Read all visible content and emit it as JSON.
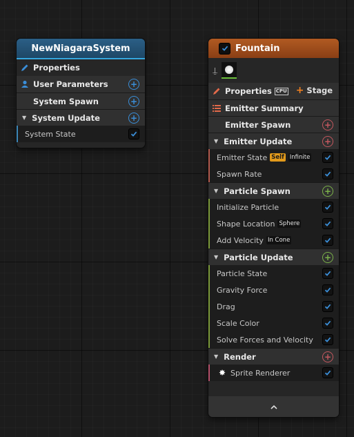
{
  "system_node": {
    "title": "NewNiagaraSystem",
    "rows": {
      "properties": "Properties",
      "user_parameters": "User Parameters",
      "system_spawn": "System Spawn",
      "system_update": "System Update",
      "system_state": "System State"
    }
  },
  "emitter_node": {
    "title": "Fountain",
    "properties": "Properties",
    "cpu_badge": "CPU",
    "stage": "Stage",
    "emitter_summary": "Emitter Summary",
    "emitter_spawn": "Emitter Spawn",
    "emitter_update": {
      "label": "Emitter Update",
      "items": {
        "emitter_state": {
          "label": "Emitter State",
          "badge1": "Self",
          "badge2": "Infinite"
        },
        "spawn_rate": "Spawn Rate"
      }
    },
    "particle_spawn": {
      "label": "Particle Spawn",
      "items": {
        "initialize_particle": "Initialize Particle",
        "shape_location": {
          "label": "Shape Location",
          "badge": "Sphere"
        },
        "add_velocity": {
          "label": "Add Velocity",
          "badge": "In Cone"
        }
      }
    },
    "particle_update": {
      "label": "Particle Update",
      "items": {
        "particle_state": "Particle State",
        "gravity_force": "Gravity Force",
        "drag": "Drag",
        "scale_color": "Scale Color",
        "solve_forces": "Solve Forces and Velocity"
      }
    },
    "render": {
      "label": "Render",
      "items": {
        "sprite_renderer": "Sprite Renderer"
      }
    }
  },
  "colors": {
    "system_accent": "#35a7e0",
    "emitter_accent": "#b15a22",
    "checkbox": "#3a8ed8"
  }
}
